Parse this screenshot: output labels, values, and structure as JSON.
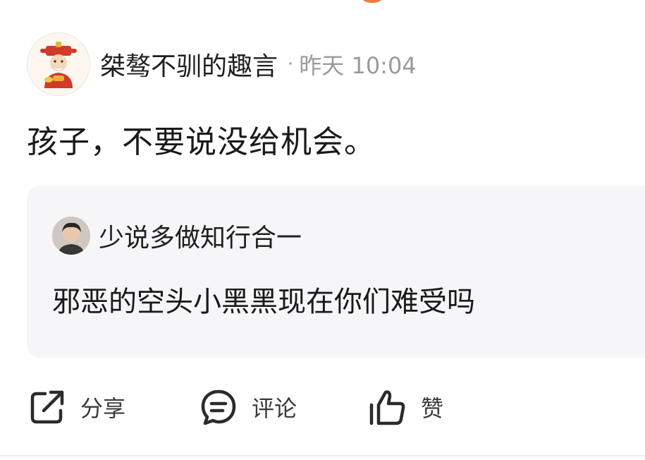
{
  "post": {
    "author": "桀骜不驯的趣言",
    "separator": "·",
    "time": "昨天 10:04",
    "text": "孩子，不要说没给机会。"
  },
  "quote": {
    "author": "少说多做知行合一",
    "text": "邪恶的空头小黑黑现在你们难受吗"
  },
  "actions": {
    "share": "分享",
    "comment": "评论",
    "like": "赞"
  },
  "icons": {
    "share": "share-icon",
    "comment": "comment-icon",
    "like": "thumbs-up-icon"
  },
  "colors": {
    "text": "#1a1a1a",
    "meta": "#9a9a9a",
    "quote_bg": "#f6f6f8",
    "accent_peek": "#f07a3a"
  }
}
